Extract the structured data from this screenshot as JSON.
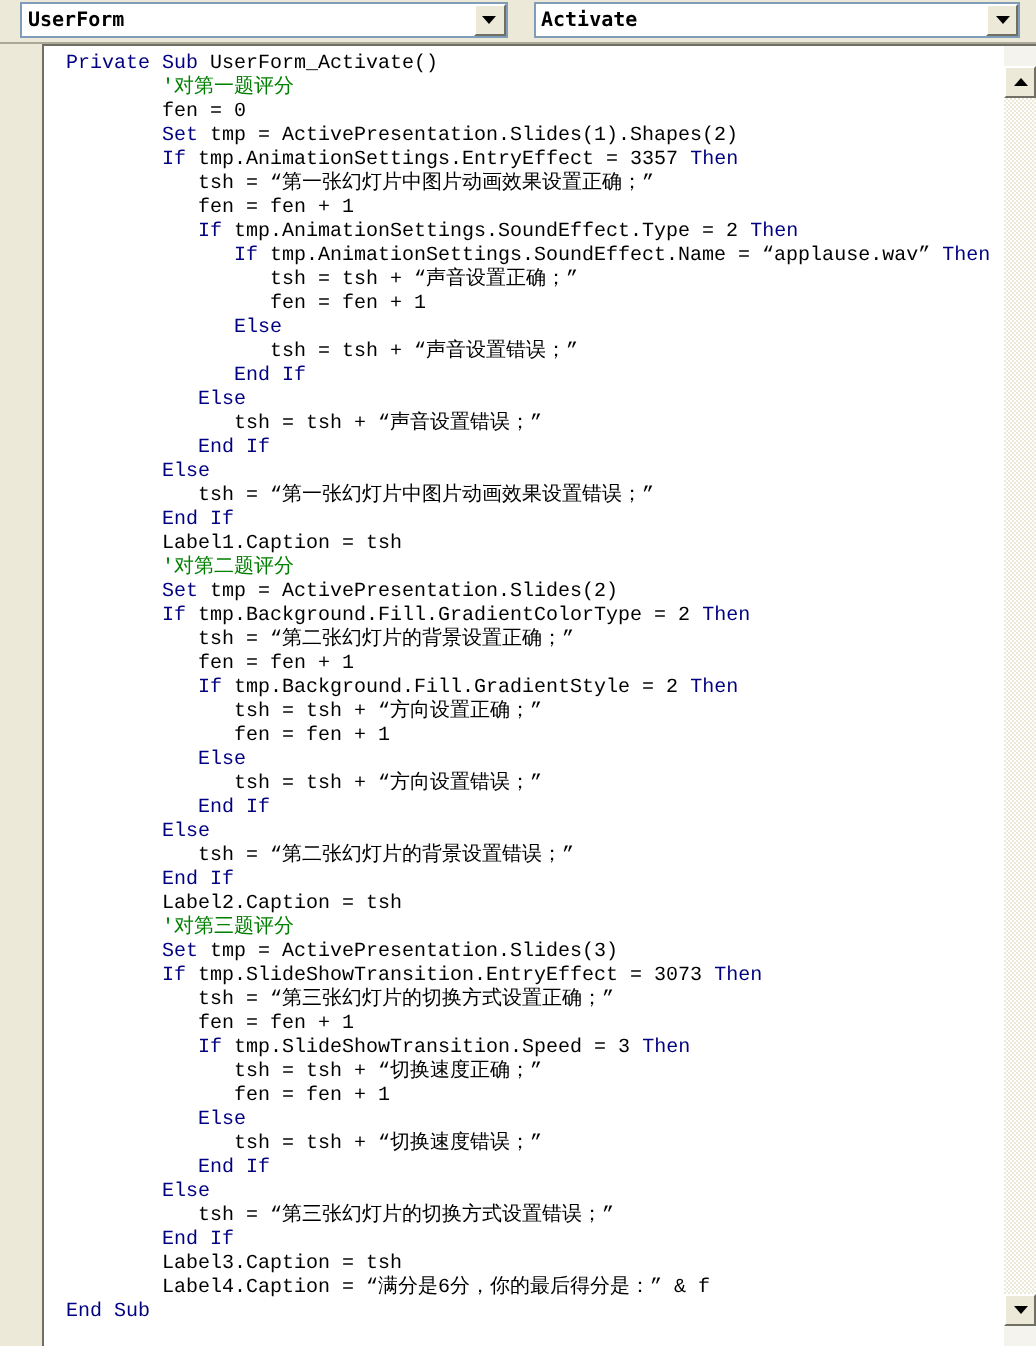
{
  "dropdowns": [
    {
      "value": "UserForm"
    },
    {
      "value": "Activate"
    }
  ],
  "code_lines": [
    [
      {
        "kind": "keyword",
        "text": "Private Sub"
      },
      {
        "kind": "code",
        "text": " UserForm_Activate()"
      }
    ],
    [
      {
        "kind": "comment",
        "text": "        '对第一题评分"
      }
    ],
    [
      {
        "kind": "code",
        "text": "        fen = 0"
      }
    ],
    [
      {
        "kind": "keyword",
        "text": "        Set"
      },
      {
        "kind": "code",
        "text": " tmp = ActivePresentation.Slides(1).Shapes(2)"
      }
    ],
    [
      {
        "kind": "keyword",
        "text": "        If"
      },
      {
        "kind": "code",
        "text": " tmp.AnimationSettings.EntryEffect = 3357 "
      },
      {
        "kind": "keyword",
        "text": "Then"
      }
    ],
    [
      {
        "kind": "code",
        "text": "           tsh = “第一张幻灯片中图片动画效果设置正确；”"
      }
    ],
    [
      {
        "kind": "code",
        "text": "           fen = fen + 1"
      }
    ],
    [
      {
        "kind": "keyword",
        "text": "           If"
      },
      {
        "kind": "code",
        "text": " tmp.AnimationSettings.SoundEffect.Type = 2 "
      },
      {
        "kind": "keyword",
        "text": "Then"
      }
    ],
    [
      {
        "kind": "keyword",
        "text": "              If"
      },
      {
        "kind": "code",
        "text": " tmp.AnimationSettings.SoundEffect.Name = “applause.wav” "
      },
      {
        "kind": "keyword",
        "text": "Then"
      }
    ],
    [
      {
        "kind": "code",
        "text": "                 tsh = tsh + “声音设置正确；”"
      }
    ],
    [
      {
        "kind": "code",
        "text": "                 fen = fen + 1"
      }
    ],
    [
      {
        "kind": "keyword",
        "text": "              Else"
      }
    ],
    [
      {
        "kind": "code",
        "text": "                 tsh = tsh + “声音设置错误；”"
      }
    ],
    [
      {
        "kind": "keyword",
        "text": "              End If"
      }
    ],
    [
      {
        "kind": "keyword",
        "text": "           Else"
      }
    ],
    [
      {
        "kind": "code",
        "text": "              tsh = tsh + “声音设置错误；”"
      }
    ],
    [
      {
        "kind": "keyword",
        "text": "           End If"
      }
    ],
    [
      {
        "kind": "keyword",
        "text": "        Else"
      }
    ],
    [
      {
        "kind": "code",
        "text": "           tsh = “第一张幻灯片中图片动画效果设置错误；”"
      }
    ],
    [
      {
        "kind": "keyword",
        "text": "        End If"
      }
    ],
    [
      {
        "kind": "code",
        "text": "        Label1.Caption = tsh"
      }
    ],
    [
      {
        "kind": "comment",
        "text": "        '对第二题评分"
      }
    ],
    [
      {
        "kind": "keyword",
        "text": "        Set"
      },
      {
        "kind": "code",
        "text": " tmp = ActivePresentation.Slides(2)"
      }
    ],
    [
      {
        "kind": "keyword",
        "text": "        If"
      },
      {
        "kind": "code",
        "text": " tmp.Background.Fill.GradientColorType = 2 "
      },
      {
        "kind": "keyword",
        "text": "Then"
      }
    ],
    [
      {
        "kind": "code",
        "text": "           tsh = “第二张幻灯片的背景设置正确；”"
      }
    ],
    [
      {
        "kind": "code",
        "text": "           fen = fen + 1"
      }
    ],
    [
      {
        "kind": "keyword",
        "text": "           If"
      },
      {
        "kind": "code",
        "text": " tmp.Background.Fill.GradientStyle = 2 "
      },
      {
        "kind": "keyword",
        "text": "Then"
      }
    ],
    [
      {
        "kind": "code",
        "text": "              tsh = tsh + “方向设置正确；”"
      }
    ],
    [
      {
        "kind": "code",
        "text": "              fen = fen + 1"
      }
    ],
    [
      {
        "kind": "keyword",
        "text": "           Else"
      }
    ],
    [
      {
        "kind": "code",
        "text": "              tsh = tsh + “方向设置错误；”"
      }
    ],
    [
      {
        "kind": "keyword",
        "text": "           End If"
      }
    ],
    [
      {
        "kind": "keyword",
        "text": "        Else"
      }
    ],
    [
      {
        "kind": "code",
        "text": "           tsh = “第二张幻灯片的背景设置错误；”"
      }
    ],
    [
      {
        "kind": "keyword",
        "text": "        End If"
      }
    ],
    [
      {
        "kind": "code",
        "text": "        Label2.Caption = tsh"
      }
    ],
    [
      {
        "kind": "comment",
        "text": "        '对第三题评分"
      }
    ],
    [
      {
        "kind": "keyword",
        "text": "        Set"
      },
      {
        "kind": "code",
        "text": " tmp = ActivePresentation.Slides(3)"
      }
    ],
    [
      {
        "kind": "keyword",
        "text": "        If"
      },
      {
        "kind": "code",
        "text": " tmp.SlideShowTransition.EntryEffect = 3073 "
      },
      {
        "kind": "keyword",
        "text": "Then"
      }
    ],
    [
      {
        "kind": "code",
        "text": "           tsh = “第三张幻灯片的切换方式设置正确；”"
      }
    ],
    [
      {
        "kind": "code",
        "text": "           fen = fen + 1"
      }
    ],
    [
      {
        "kind": "keyword",
        "text": "           If"
      },
      {
        "kind": "code",
        "text": " tmp.SlideShowTransition.Speed = 3 "
      },
      {
        "kind": "keyword",
        "text": "Then"
      }
    ],
    [
      {
        "kind": "code",
        "text": "              tsh = tsh + “切换速度正确；”"
      }
    ],
    [
      {
        "kind": "code",
        "text": "              fen = fen + 1"
      }
    ],
    [
      {
        "kind": "keyword",
        "text": "           Else"
      }
    ],
    [
      {
        "kind": "code",
        "text": "              tsh = tsh + “切换速度错误；”"
      }
    ],
    [
      {
        "kind": "keyword",
        "text": "           End If"
      }
    ],
    [
      {
        "kind": "keyword",
        "text": "        Else"
      }
    ],
    [
      {
        "kind": "code",
        "text": "           tsh = “第三张幻灯片的切换方式设置错误；”"
      }
    ],
    [
      {
        "kind": "keyword",
        "text": "        End If"
      }
    ],
    [
      {
        "kind": "code",
        "text": "        Label3.Caption = tsh"
      }
    ],
    [
      {
        "kind": "code",
        "text": "        Label4.Caption = “满分是6分，你的最后得分是：” & f"
      }
    ],
    [
      {
        "kind": "keyword",
        "text": "End Sub"
      }
    ]
  ]
}
